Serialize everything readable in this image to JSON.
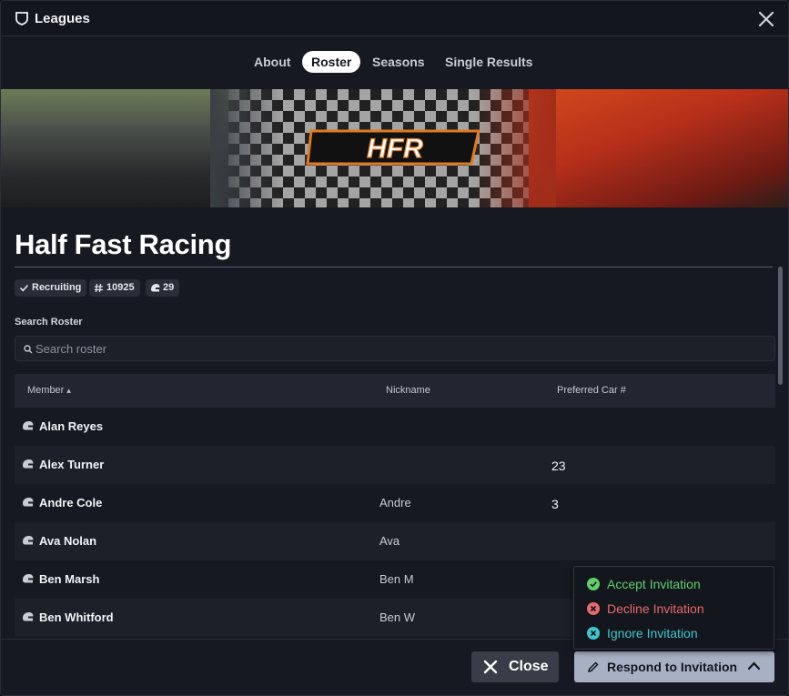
{
  "window": {
    "title": "Leagues"
  },
  "tabs": [
    {
      "label": "About"
    },
    {
      "label": "Roster"
    },
    {
      "label": "Seasons"
    },
    {
      "label": "Single Results"
    }
  ],
  "banner": {
    "logo_text": "HFR"
  },
  "team": {
    "name": "Half Fast Racing"
  },
  "chips": {
    "recruiting": "Recruiting",
    "id": "10925",
    "members": "29"
  },
  "search": {
    "label": "Search Roster",
    "placeholder": "Search roster"
  },
  "table": {
    "headers": {
      "member": "Member",
      "nickname": "Nickname",
      "car": "Preferred Car #"
    },
    "rows": [
      {
        "name": "Alan Reyes",
        "nickname": "",
        "car": ""
      },
      {
        "name": "Alex Turner",
        "nickname": "",
        "car": "23"
      },
      {
        "name": "Andre Cole",
        "nickname": "Andre",
        "car": "3"
      },
      {
        "name": "Ava Nolan",
        "nickname": "Ava",
        "car": ""
      },
      {
        "name": "Ben Marsh",
        "nickname": "Ben M",
        "car": ""
      },
      {
        "name": "Ben Whitford",
        "nickname": "Ben W",
        "car": ""
      }
    ]
  },
  "menu": {
    "accept": "Accept Invitation",
    "decline": "Decline Invitation",
    "ignore": "Ignore Invitation"
  },
  "footer": {
    "close_label": "Close",
    "respond_label": "Respond to Invitation"
  },
  "colors": {
    "accept": "#5fd06a",
    "decline": "#e46b6b",
    "ignore": "#3ec6cf"
  }
}
